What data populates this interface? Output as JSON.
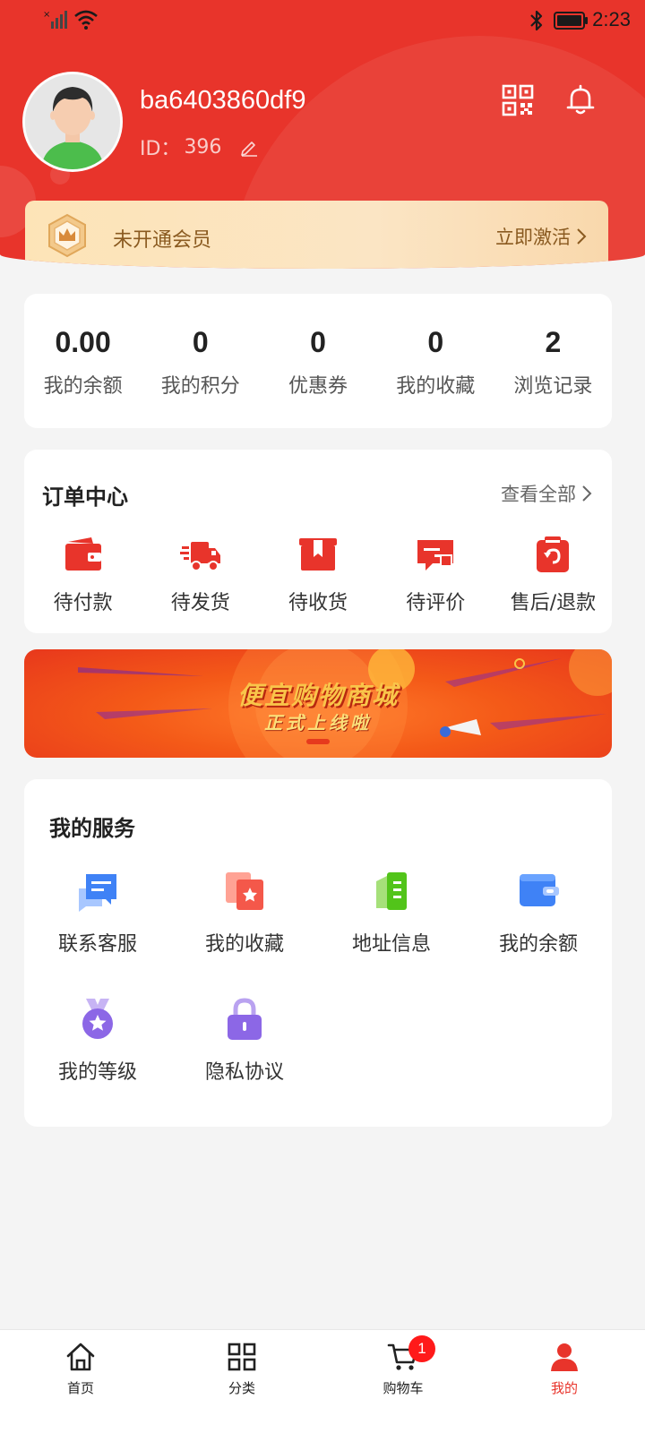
{
  "status_bar": {
    "time": "2:23"
  },
  "profile": {
    "username": "ba6403860df9",
    "id_label": "ID：",
    "id_value": "396"
  },
  "membership": {
    "status": "未开通会员",
    "action": "立即激活"
  },
  "stats": [
    {
      "value": "0.00",
      "label": "我的余额"
    },
    {
      "value": "0",
      "label": "我的积分"
    },
    {
      "value": "0",
      "label": "优惠券"
    },
    {
      "value": "0",
      "label": "我的收藏"
    },
    {
      "value": "2",
      "label": "浏览记录"
    }
  ],
  "orders": {
    "title": "订单中心",
    "view_all": "查看全部",
    "items": [
      {
        "label": "待付款",
        "icon": "wallet-icon"
      },
      {
        "label": "待发货",
        "icon": "truck-icon"
      },
      {
        "label": "待收货",
        "icon": "package-icon"
      },
      {
        "label": "待评价",
        "icon": "review-icon"
      },
      {
        "label": "售后/退款",
        "icon": "refund-icon"
      }
    ]
  },
  "banner": {
    "title": "便宜购物商城",
    "subtitle": "正式上线啦"
  },
  "services": {
    "title": "我的服务",
    "items": [
      {
        "label": "联系客服",
        "icon": "chat-icon"
      },
      {
        "label": "我的收藏",
        "icon": "favorite-icon"
      },
      {
        "label": "地址信息",
        "icon": "address-icon"
      },
      {
        "label": "我的余额",
        "icon": "balance-icon"
      },
      {
        "label": "我的等级",
        "icon": "medal-icon"
      },
      {
        "label": "隐私协议",
        "icon": "lock-icon"
      }
    ]
  },
  "tabbar": {
    "items": [
      {
        "label": "首页",
        "icon": "home-icon"
      },
      {
        "label": "分类",
        "icon": "category-icon"
      },
      {
        "label": "购物车",
        "icon": "cart-icon",
        "badge": "1"
      },
      {
        "label": "我的",
        "icon": "user-icon",
        "active": true
      }
    ]
  },
  "colors": {
    "primary": "#e8342b",
    "member_text": "#8a5a20",
    "background": "#f4f4f4"
  }
}
